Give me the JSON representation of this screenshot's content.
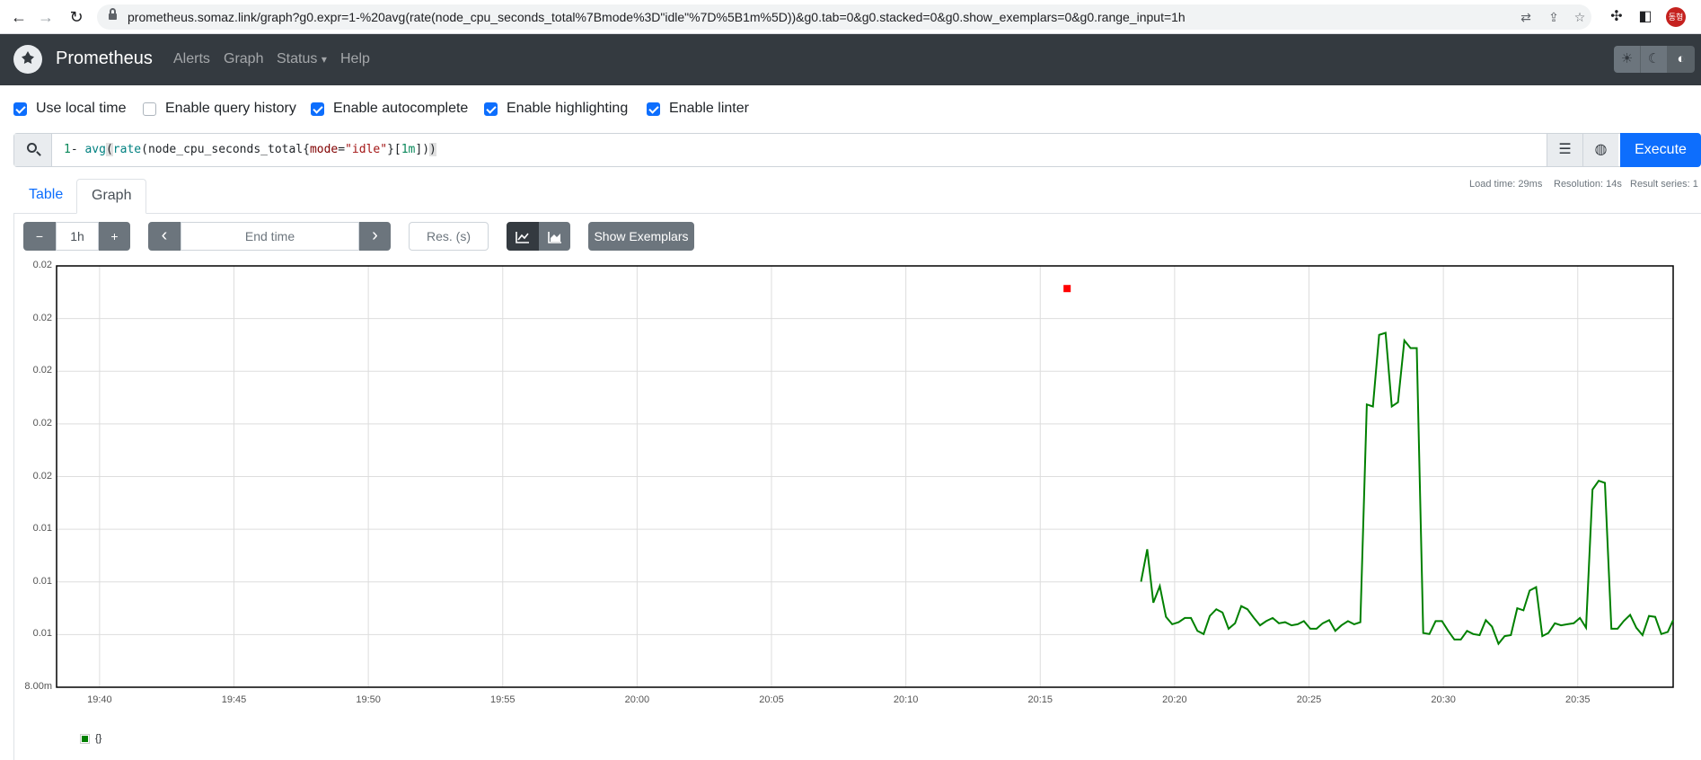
{
  "browser": {
    "back_icon": "←",
    "forward_icon": "→",
    "reload_icon": "↻",
    "url": "prometheus.somaz.link/graph?g0.expr=1-%20avg(rate(node_cpu_seconds_total%7Bmode%3D\"idle\"%7D%5B1m%5D))&g0.tab=0&g0.stacked=0&g0.show_exemplars=0&g0.range_input=1h",
    "profile_initials": "동형"
  },
  "navbar": {
    "brand": "Prometheus",
    "links": [
      "Alerts",
      "Graph",
      "Status",
      "Help"
    ],
    "status_caret": "▾"
  },
  "options": {
    "use_local_time": {
      "label": "Use local time",
      "checked": true
    },
    "enable_query_history": {
      "label": "Enable query history",
      "checked": false
    },
    "enable_autocomplete": {
      "label": "Enable autocomplete",
      "checked": true
    },
    "enable_highlighting": {
      "label": "Enable highlighting",
      "checked": true
    },
    "enable_linter": {
      "label": "Enable linter",
      "checked": true
    }
  },
  "expression": {
    "tokens": [
      "1",
      "- ",
      "avg",
      "(",
      "rate",
      "(",
      "node_cpu_seconds_total",
      "{",
      "mode",
      "=",
      "\"idle\"",
      "}",
      "[",
      "1m",
      "]",
      ")",
      ")"
    ],
    "execute_label": "Execute"
  },
  "stats": {
    "load_time": "Load time: 29ms",
    "resolution": "Resolution: 14s",
    "result_series": "Result series: 1"
  },
  "tabs": {
    "table": "Table",
    "graph": "Graph"
  },
  "controls": {
    "minus": "−",
    "range": "1h",
    "plus": "+",
    "prev": "‹",
    "end_time_placeholder": "End time",
    "next": "›",
    "resolution_placeholder": "Res. (s)",
    "show_exemplars": "Show Exemplars"
  },
  "colors": {
    "series": "#008000",
    "exemplar_marker": "#ff0000",
    "primary": "#0d6efd",
    "navbar": "#343a40"
  },
  "chart_data": {
    "type": "line",
    "y_tick_labels": [
      "0.02",
      "0.02",
      "0.02",
      "0.02",
      "0.02",
      "0.01",
      "0.01",
      "0.01",
      "8.00m"
    ],
    "y_tick_values": [
      0.024,
      0.022,
      0.02,
      0.018,
      0.016,
      0.014,
      0.012,
      0.01,
      0.008
    ],
    "ylim": [
      0.008,
      0.024
    ],
    "x_tick_labels": [
      "19:40",
      "19:45",
      "19:50",
      "19:55",
      "20:00",
      "20:05",
      "20:10",
      "20:15",
      "20:20",
      "20:25",
      "20:30",
      "20:35"
    ],
    "x_tick_minutes": [
      1180,
      1185,
      1190,
      1195,
      1200,
      1205,
      1210,
      1215,
      1220,
      1225,
      1230,
      1235
    ],
    "xlim_minutes": [
      1178.4,
      1238.55
    ],
    "grid": true,
    "legend": {
      "label": "{}",
      "position": "bottom-left"
    },
    "series": [
      {
        "name": "{}",
        "x_minutes": [
          1218.75,
          1218.98,
          1219.21,
          1219.45,
          1219.68,
          1219.91,
          1220.15,
          1220.38,
          1220.61,
          1220.85,
          1221.08,
          1221.31,
          1221.55,
          1221.78,
          1222.01,
          1222.25,
          1222.48,
          1222.71,
          1222.95,
          1223.18,
          1223.41,
          1223.65,
          1223.88,
          1224.11,
          1224.35,
          1224.58,
          1224.81,
          1225.05,
          1225.28,
          1225.51,
          1225.75,
          1225.98,
          1226.21,
          1226.45,
          1226.68,
          1226.91,
          1227.15,
          1227.38,
          1227.61,
          1227.85,
          1228.08,
          1228.31,
          1228.55,
          1228.78,
          1229.01,
          1229.25,
          1229.48,
          1229.71,
          1229.95,
          1230.18,
          1230.41,
          1230.65,
          1230.88,
          1231.11,
          1231.35,
          1231.58,
          1231.81,
          1232.05,
          1232.28,
          1232.51,
          1232.75,
          1232.98,
          1233.21,
          1233.45,
          1233.68,
          1233.91,
          1234.15,
          1234.38,
          1234.61,
          1234.85,
          1235.08,
          1235.31,
          1235.55,
          1235.78,
          1236.01,
          1236.25,
          1236.48,
          1236.71,
          1236.95,
          1237.18,
          1237.41,
          1237.65,
          1237.88,
          1238.11,
          1238.35,
          1238.55
        ],
        "values": [
          0.01201,
          0.01324,
          0.01121,
          0.01184,
          0.01067,
          0.01039,
          0.01047,
          0.01063,
          0.01063,
          0.01014,
          0.01002,
          0.01071,
          0.01096,
          0.01084,
          0.01022,
          0.01043,
          0.01108,
          0.01096,
          0.01063,
          0.01035,
          0.01051,
          0.01063,
          0.01043,
          0.01047,
          0.01035,
          0.01039,
          0.01051,
          0.01022,
          0.01022,
          0.01043,
          0.01055,
          0.01014,
          0.01035,
          0.01051,
          0.01039,
          0.01047,
          0.01874,
          0.01866,
          0.02138,
          0.02146,
          0.01866,
          0.01882,
          0.02117,
          0.02088,
          0.02088,
          0.01006,
          0.01002,
          0.01051,
          0.01051,
          0.01014,
          0.00981,
          0.00981,
          0.01014,
          0.01002,
          0.00998,
          0.01055,
          0.0103,
          0.00965,
          0.00994,
          0.00998,
          0.011,
          0.01092,
          0.01167,
          0.0118,
          0.00994,
          0.01006,
          0.01043,
          0.01035,
          0.01039,
          0.01043,
          0.01063,
          0.01026,
          0.01551,
          0.01584,
          0.01576,
          0.01022,
          0.01022,
          0.01051,
          0.01075,
          0.01026,
          0.00998,
          0.01071,
          0.01067,
          0.01002,
          0.0101,
          0.01055
        ]
      }
    ],
    "exemplar_markers": [
      {
        "x_minute": 1216.0,
        "y": 0.02314
      }
    ]
  }
}
